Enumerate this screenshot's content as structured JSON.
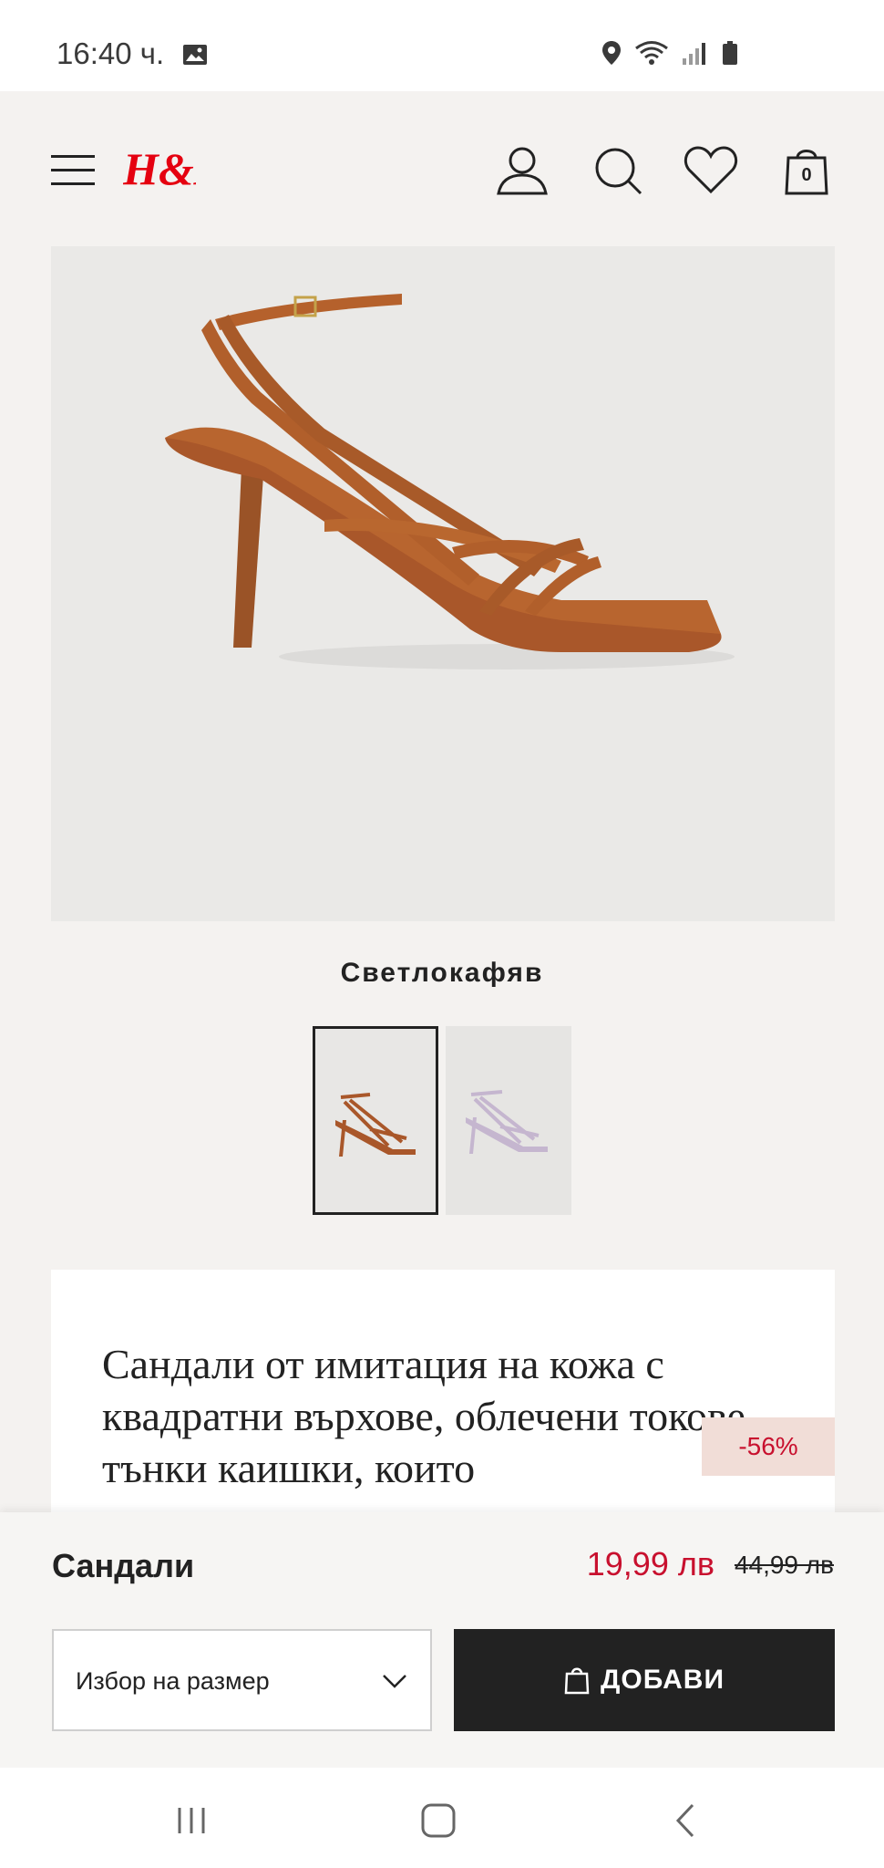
{
  "status_bar": {
    "time": "16:40 ч.",
    "icons": [
      "gallery-icon",
      "location-icon",
      "wifi-icon",
      "signal-icon",
      "battery-icon"
    ]
  },
  "header": {
    "logo_text": "H&M",
    "icons": [
      "menu-icon",
      "account-icon",
      "search-icon",
      "heart-icon",
      "bag-icon"
    ],
    "bag_count": "0",
    "brand_color": "#e50010"
  },
  "product": {
    "color_name": "Светлокафяв",
    "thumbnails": [
      {
        "label": "brown-sandal",
        "selected": true
      },
      {
        "label": "lilac-sandal",
        "selected": false
      }
    ],
    "description": "Сандали от имитация на кожа с квадратни върхове, облечени токове, тънки каишки, които",
    "discount_badge": "-56%",
    "name": "Сандали",
    "price_new": "19,99 лв",
    "price_old": "44,99 лв",
    "price_color": "#c8102e"
  },
  "actions": {
    "size_select_label": "Избор на размер",
    "add_button_label": "ДОБАВИ"
  },
  "navbar": {
    "icons": [
      "recent-apps-icon",
      "home-icon",
      "back-icon"
    ]
  }
}
